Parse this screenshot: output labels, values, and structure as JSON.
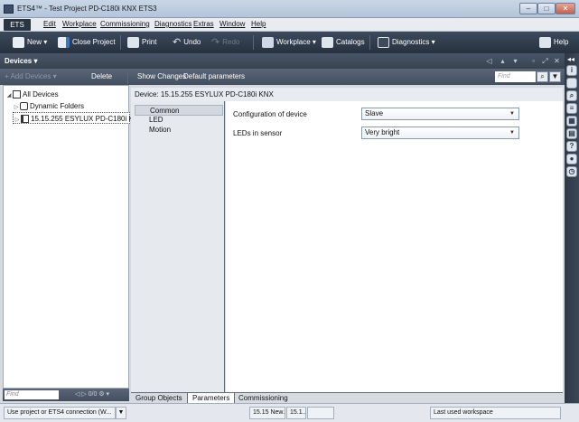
{
  "window": {
    "title": "ETS4™ - Test Project PD-C180i KNX ETS3",
    "min_label": "–",
    "max_label": "□",
    "close_label": "✕"
  },
  "menu": {
    "ets": "ETS",
    "edit": "Edit",
    "workplace": "Workplace",
    "commissioning": "Commissioning",
    "diagnostics": "Diagnostics",
    "extras": "Extras",
    "window": "Window",
    "help": "Help"
  },
  "toolbar": {
    "new": "New ▾",
    "close_project": "Close Project",
    "print": "Print",
    "undo": "Undo",
    "redo": "Redo",
    "workplace": "Workplace ▾",
    "catalogs": "Catalogs",
    "diagnostics": "Diagnostics ▾",
    "help": "Help"
  },
  "panel": {
    "title": "Devices ▾",
    "find_placeholder": "Find",
    "add_devices": "Add Devices ▾",
    "delete": "Delete",
    "show_changes": "Show Changes",
    "default_parameters": "Default parameters"
  },
  "tree": {
    "items": [
      {
        "label": "All Devices",
        "arrow": "◢"
      },
      {
        "label": "Dynamic Folders",
        "arrow": "▷"
      },
      {
        "label": "15.15.255  ESYLUX PD-C180i KNX",
        "arrow": "▷"
      }
    ],
    "find_placeholder": "Find",
    "pager": "◁ ▷ 0/0  ⚙ ▾"
  },
  "device": {
    "header": "Device: 15.15.255  ESYLUX PD-C180i KNX",
    "nav": [
      "Common",
      "LED",
      "Motion"
    ],
    "params": [
      {
        "label": "Configuration of device",
        "value": "Slave"
      },
      {
        "label": "LEDs in sensor",
        "value": "Very bright"
      }
    ]
  },
  "tabs": [
    "Group Objects",
    "Parameters",
    "Commissioning"
  ],
  "status": {
    "connection": "Use project or ETS4 connection (W...",
    "line": "15.15 New...",
    "device": "15.1...",
    "workspace": "Last used workspace"
  },
  "side_icons": [
    "info-icon",
    "folder-icon",
    "search-icon",
    "list-icon",
    "grid-icon",
    "calendar-icon",
    "question-icon",
    "tag-icon",
    "clock-icon"
  ]
}
